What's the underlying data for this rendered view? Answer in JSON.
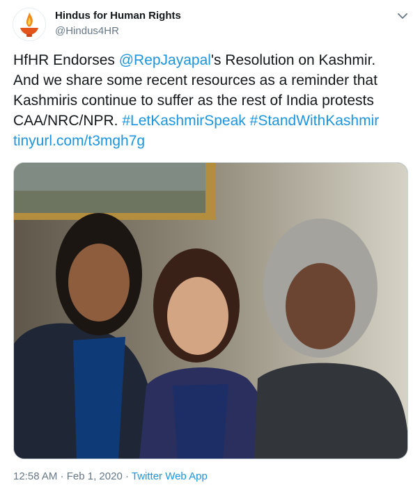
{
  "author": {
    "name": "Hindus for Human Rights",
    "handle": "@Hindus4HR",
    "avatar_icon": "flame-lamp-icon"
  },
  "menu_icon": "chevron-down-icon",
  "tweet": {
    "line1_pre": "HfHR Endorses ",
    "mention": "@RepJayapal",
    "line1_post": "'s Resolution on Kashmir.",
    "line2": "And we share some recent resources as a reminder that",
    "line3": "Kashmiris continue to suffer as the rest of India protests",
    "line4_pre": "CAA/NRC/NPR. ",
    "hashtag1": "#LetKashmirSpeak",
    "hashtag2": "#StandWithKashmir",
    "link": "tinyurl.com/t3mgh7g"
  },
  "meta": {
    "time": "12:58 AM",
    "sep": " · ",
    "date": "Feb 1, 2020",
    "sep2": " · ",
    "app": "Twitter Web App"
  },
  "colors": {
    "link": "#1b95e0",
    "text": "#14171a",
    "secondary": "#657786"
  }
}
